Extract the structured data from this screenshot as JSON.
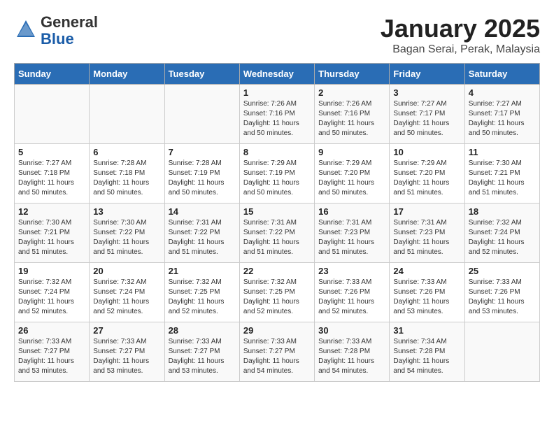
{
  "header": {
    "logo": {
      "line1": "General",
      "line2": "Blue"
    },
    "title": "January 2025",
    "subtitle": "Bagan Serai, Perak, Malaysia"
  },
  "weekdays": [
    "Sunday",
    "Monday",
    "Tuesday",
    "Wednesday",
    "Thursday",
    "Friday",
    "Saturday"
  ],
  "weeks": [
    [
      {
        "day": "",
        "sunrise": "",
        "sunset": "",
        "daylight": ""
      },
      {
        "day": "",
        "sunrise": "",
        "sunset": "",
        "daylight": ""
      },
      {
        "day": "",
        "sunrise": "",
        "sunset": "",
        "daylight": ""
      },
      {
        "day": "1",
        "sunrise": "Sunrise: 7:26 AM",
        "sunset": "Sunset: 7:16 PM",
        "daylight": "Daylight: 11 hours and 50 minutes."
      },
      {
        "day": "2",
        "sunrise": "Sunrise: 7:26 AM",
        "sunset": "Sunset: 7:16 PM",
        "daylight": "Daylight: 11 hours and 50 minutes."
      },
      {
        "day": "3",
        "sunrise": "Sunrise: 7:27 AM",
        "sunset": "Sunset: 7:17 PM",
        "daylight": "Daylight: 11 hours and 50 minutes."
      },
      {
        "day": "4",
        "sunrise": "Sunrise: 7:27 AM",
        "sunset": "Sunset: 7:17 PM",
        "daylight": "Daylight: 11 hours and 50 minutes."
      }
    ],
    [
      {
        "day": "5",
        "sunrise": "Sunrise: 7:27 AM",
        "sunset": "Sunset: 7:18 PM",
        "daylight": "Daylight: 11 hours and 50 minutes."
      },
      {
        "day": "6",
        "sunrise": "Sunrise: 7:28 AM",
        "sunset": "Sunset: 7:18 PM",
        "daylight": "Daylight: 11 hours and 50 minutes."
      },
      {
        "day": "7",
        "sunrise": "Sunrise: 7:28 AM",
        "sunset": "Sunset: 7:19 PM",
        "daylight": "Daylight: 11 hours and 50 minutes."
      },
      {
        "day": "8",
        "sunrise": "Sunrise: 7:29 AM",
        "sunset": "Sunset: 7:19 PM",
        "daylight": "Daylight: 11 hours and 50 minutes."
      },
      {
        "day": "9",
        "sunrise": "Sunrise: 7:29 AM",
        "sunset": "Sunset: 7:20 PM",
        "daylight": "Daylight: 11 hours and 50 minutes."
      },
      {
        "day": "10",
        "sunrise": "Sunrise: 7:29 AM",
        "sunset": "Sunset: 7:20 PM",
        "daylight": "Daylight: 11 hours and 51 minutes."
      },
      {
        "day": "11",
        "sunrise": "Sunrise: 7:30 AM",
        "sunset": "Sunset: 7:21 PM",
        "daylight": "Daylight: 11 hours and 51 minutes."
      }
    ],
    [
      {
        "day": "12",
        "sunrise": "Sunrise: 7:30 AM",
        "sunset": "Sunset: 7:21 PM",
        "daylight": "Daylight: 11 hours and 51 minutes."
      },
      {
        "day": "13",
        "sunrise": "Sunrise: 7:30 AM",
        "sunset": "Sunset: 7:22 PM",
        "daylight": "Daylight: 11 hours and 51 minutes."
      },
      {
        "day": "14",
        "sunrise": "Sunrise: 7:31 AM",
        "sunset": "Sunset: 7:22 PM",
        "daylight": "Daylight: 11 hours and 51 minutes."
      },
      {
        "day": "15",
        "sunrise": "Sunrise: 7:31 AM",
        "sunset": "Sunset: 7:22 PM",
        "daylight": "Daylight: 11 hours and 51 minutes."
      },
      {
        "day": "16",
        "sunrise": "Sunrise: 7:31 AM",
        "sunset": "Sunset: 7:23 PM",
        "daylight": "Daylight: 11 hours and 51 minutes."
      },
      {
        "day": "17",
        "sunrise": "Sunrise: 7:31 AM",
        "sunset": "Sunset: 7:23 PM",
        "daylight": "Daylight: 11 hours and 51 minutes."
      },
      {
        "day": "18",
        "sunrise": "Sunrise: 7:32 AM",
        "sunset": "Sunset: 7:24 PM",
        "daylight": "Daylight: 11 hours and 52 minutes."
      }
    ],
    [
      {
        "day": "19",
        "sunrise": "Sunrise: 7:32 AM",
        "sunset": "Sunset: 7:24 PM",
        "daylight": "Daylight: 11 hours and 52 minutes."
      },
      {
        "day": "20",
        "sunrise": "Sunrise: 7:32 AM",
        "sunset": "Sunset: 7:24 PM",
        "daylight": "Daylight: 11 hours and 52 minutes."
      },
      {
        "day": "21",
        "sunrise": "Sunrise: 7:32 AM",
        "sunset": "Sunset: 7:25 PM",
        "daylight": "Daylight: 11 hours and 52 minutes."
      },
      {
        "day": "22",
        "sunrise": "Sunrise: 7:32 AM",
        "sunset": "Sunset: 7:25 PM",
        "daylight": "Daylight: 11 hours and 52 minutes."
      },
      {
        "day": "23",
        "sunrise": "Sunrise: 7:33 AM",
        "sunset": "Sunset: 7:26 PM",
        "daylight": "Daylight: 11 hours and 52 minutes."
      },
      {
        "day": "24",
        "sunrise": "Sunrise: 7:33 AM",
        "sunset": "Sunset: 7:26 PM",
        "daylight": "Daylight: 11 hours and 53 minutes."
      },
      {
        "day": "25",
        "sunrise": "Sunrise: 7:33 AM",
        "sunset": "Sunset: 7:26 PM",
        "daylight": "Daylight: 11 hours and 53 minutes."
      }
    ],
    [
      {
        "day": "26",
        "sunrise": "Sunrise: 7:33 AM",
        "sunset": "Sunset: 7:27 PM",
        "daylight": "Daylight: 11 hours and 53 minutes."
      },
      {
        "day": "27",
        "sunrise": "Sunrise: 7:33 AM",
        "sunset": "Sunset: 7:27 PM",
        "daylight": "Daylight: 11 hours and 53 minutes."
      },
      {
        "day": "28",
        "sunrise": "Sunrise: 7:33 AM",
        "sunset": "Sunset: 7:27 PM",
        "daylight": "Daylight: 11 hours and 53 minutes."
      },
      {
        "day": "29",
        "sunrise": "Sunrise: 7:33 AM",
        "sunset": "Sunset: 7:27 PM",
        "daylight": "Daylight: 11 hours and 54 minutes."
      },
      {
        "day": "30",
        "sunrise": "Sunrise: 7:33 AM",
        "sunset": "Sunset: 7:28 PM",
        "daylight": "Daylight: 11 hours and 54 minutes."
      },
      {
        "day": "31",
        "sunrise": "Sunrise: 7:34 AM",
        "sunset": "Sunset: 7:28 PM",
        "daylight": "Daylight: 11 hours and 54 minutes."
      },
      {
        "day": "",
        "sunrise": "",
        "sunset": "",
        "daylight": ""
      }
    ]
  ]
}
